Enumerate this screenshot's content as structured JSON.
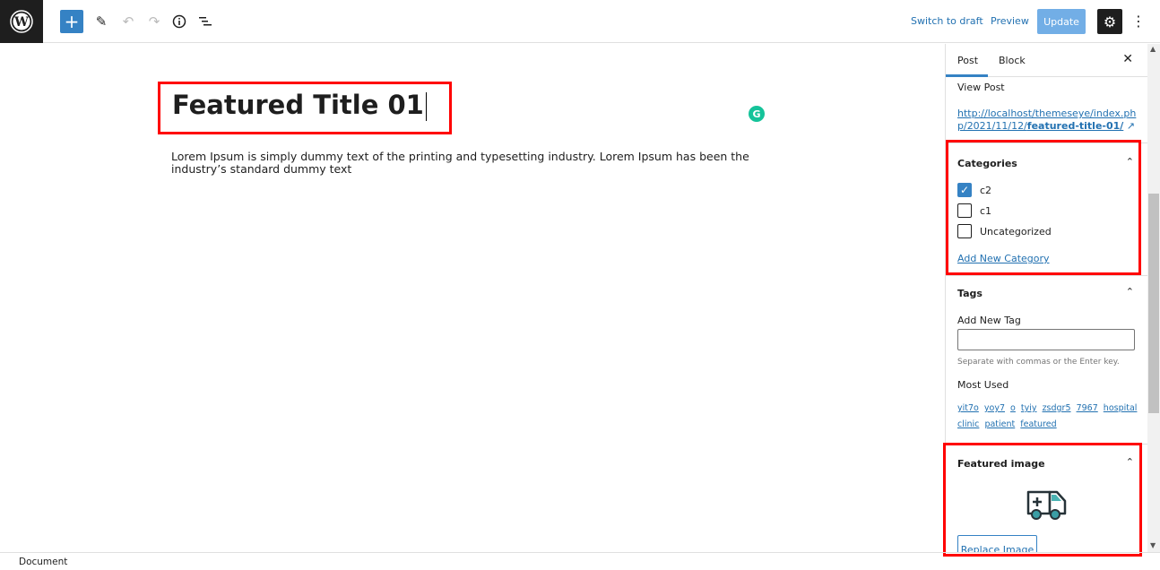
{
  "toolbar": {
    "switch_draft": "Switch to draft",
    "preview": "Preview",
    "update": "Update"
  },
  "editor": {
    "title": "Featured Title 01",
    "paragraph": "Lorem Ipsum is simply dummy text of the printing and typesetting industry. Lorem Ipsum has been the industry’s standard dummy text"
  },
  "sidebar": {
    "tabs": [
      "Post",
      "Block"
    ],
    "view_post": "View Post",
    "permalink_prefix": "http://localhost/themeseye/index.php/2021/11/12/",
    "permalink_slug": "featured-title-01/",
    "categories": {
      "title": "Categories",
      "items": [
        {
          "label": "c2",
          "checked": true
        },
        {
          "label": "c1",
          "checked": false
        },
        {
          "label": "Uncategorized",
          "checked": false
        }
      ],
      "add_new": "Add New Category"
    },
    "tags": {
      "title": "Tags",
      "add_label": "Add New Tag",
      "input_value": "",
      "help": "Separate with commas or the Enter key.",
      "most_used": "Most Used",
      "items": [
        "yit7o",
        "yoy7",
        "o",
        "tyiy",
        "zsdgr5",
        "7967",
        "hospital",
        "clinic",
        "patient",
        "featured"
      ]
    },
    "featured_image": {
      "title": "Featured image",
      "replace": "Replace Image"
    }
  },
  "footer": {
    "breadcrumb": "Document"
  },
  "colors": {
    "accent": "#3582c4",
    "highlight": "#ff0000",
    "link": "#2271b1"
  }
}
